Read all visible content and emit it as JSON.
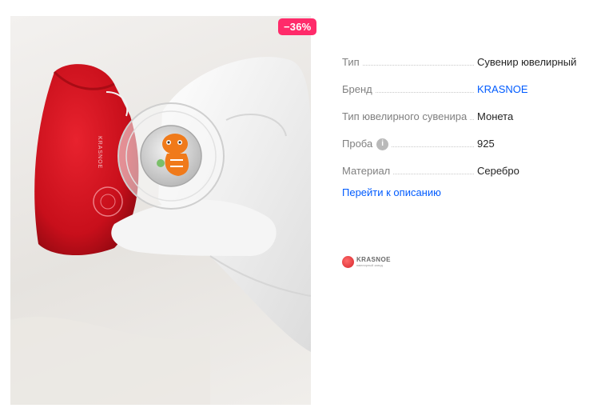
{
  "badge": {
    "discount": "−36%"
  },
  "photo": {
    "pouch_brand": "KRASNOE"
  },
  "specs": [
    {
      "name": "Тип",
      "value": "Сувенир ювелирный",
      "info": false,
      "link": false
    },
    {
      "name": "Бренд",
      "value": "KRASNOE",
      "info": false,
      "link": true
    },
    {
      "name": "Тип ювелирного сувенира",
      "value": "Монета",
      "info": false,
      "link": false
    },
    {
      "name": "Проба",
      "value": "925",
      "info": true,
      "link": false
    },
    {
      "name": "Материал",
      "value": "Серебро",
      "info": false,
      "link": false
    }
  ],
  "description_link": "Перейти к описанию",
  "brand_logo": {
    "name": "KRASNOE",
    "tagline": "ювелирный завод"
  },
  "colors": {
    "badge": "#ff2b6a",
    "link": "#005bff",
    "pouch": "#d3101e"
  },
  "icons": {
    "info": "info-icon"
  }
}
